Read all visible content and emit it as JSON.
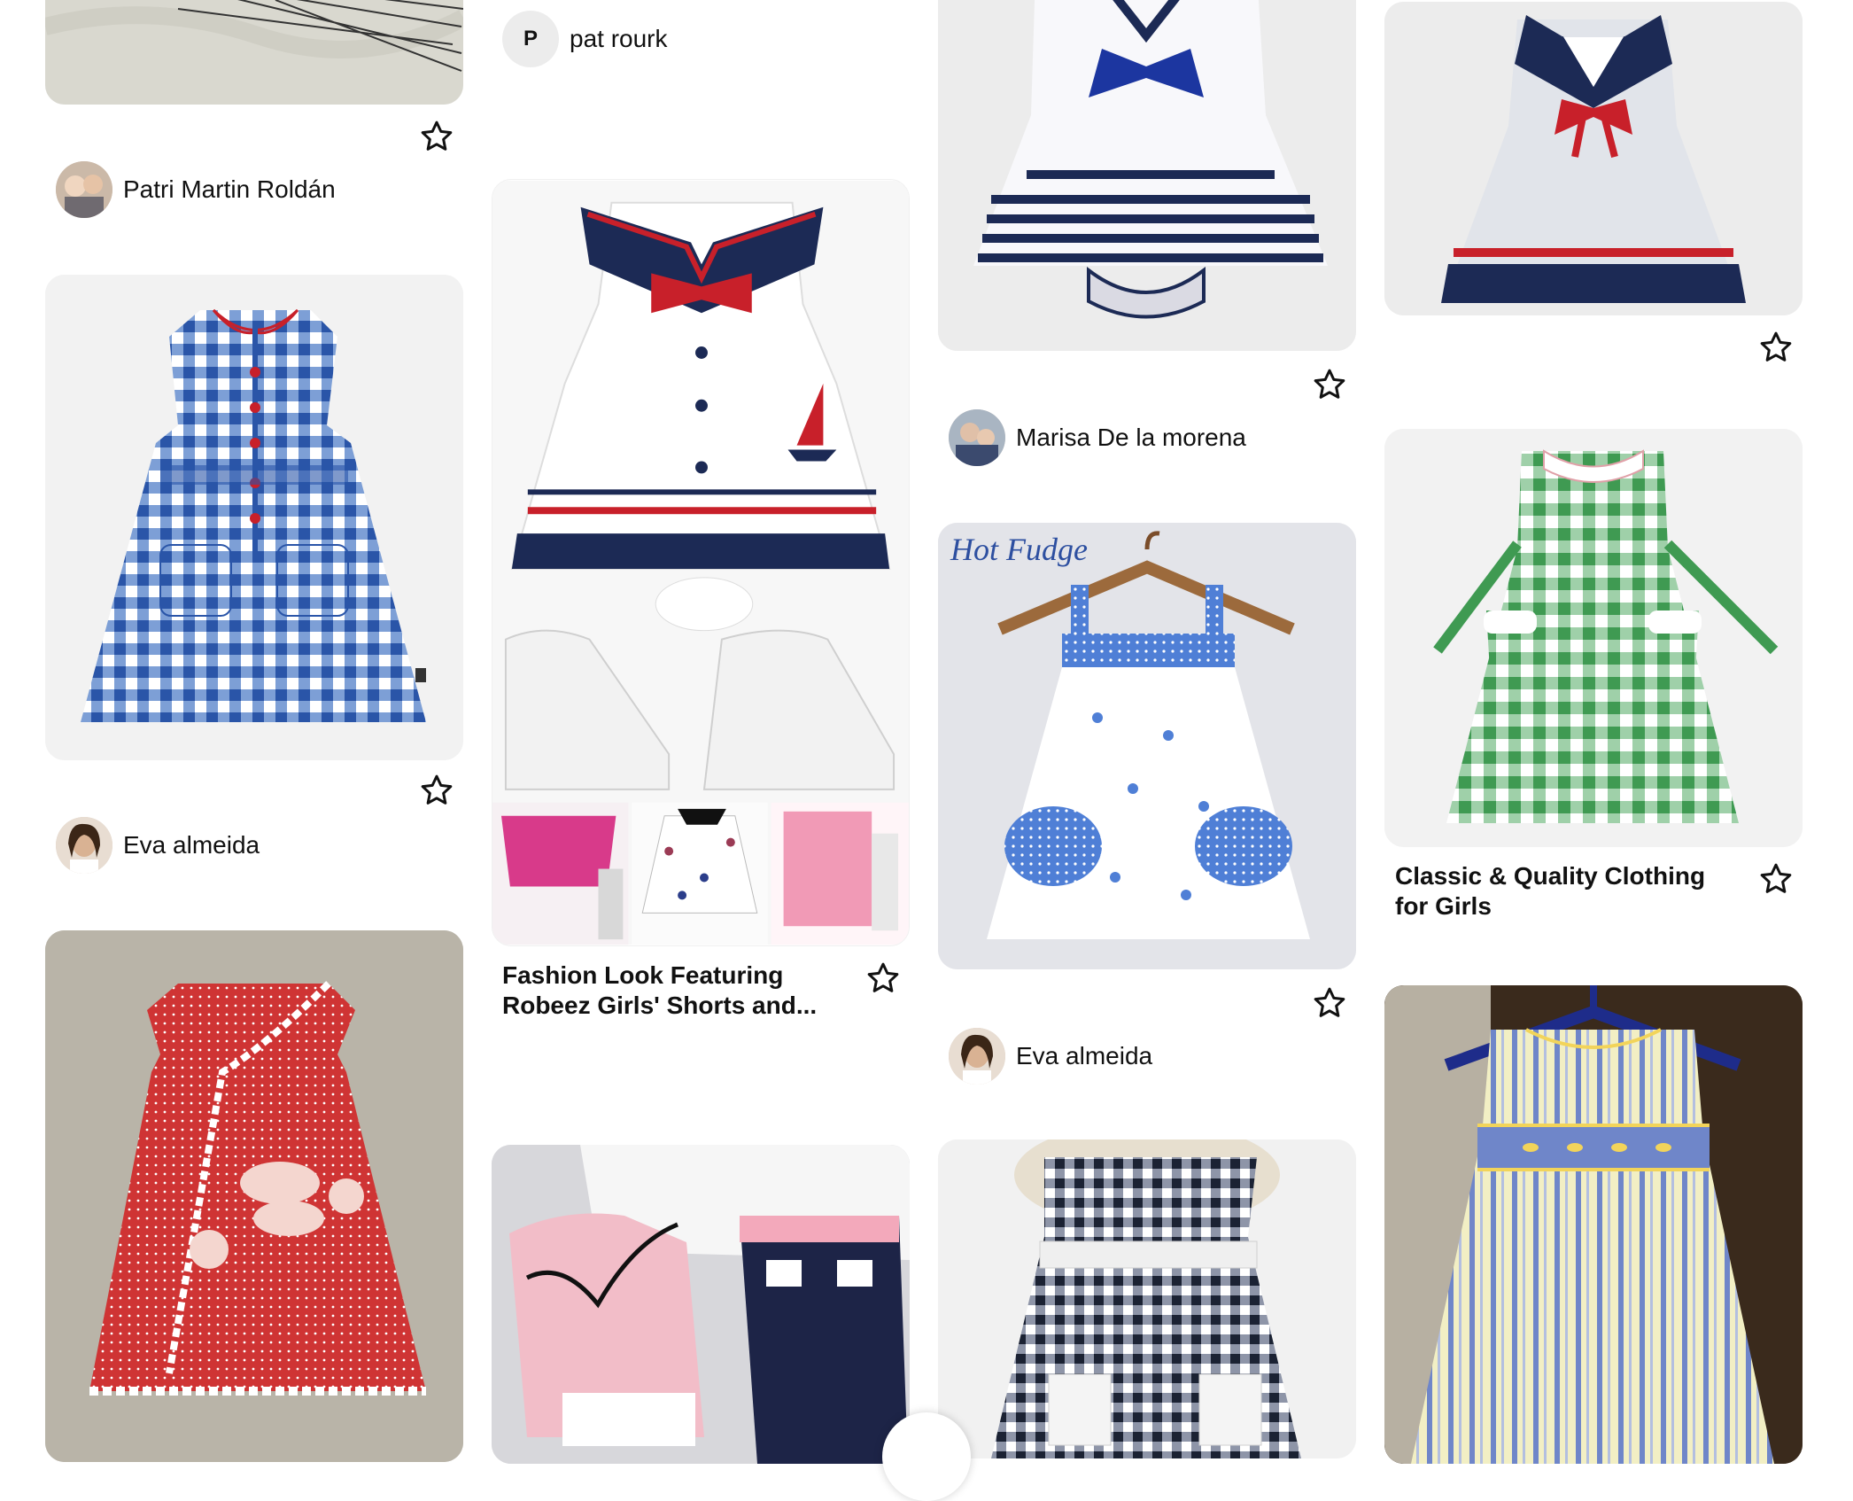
{
  "pins": {
    "c1": {
      "top_author": "Patri Martin Roldán",
      "mid_author": "Eva almeida"
    },
    "c2": {
      "top_author": "pat rourk",
      "top_author_initial": "P",
      "mid_title": "Fashion Look Featuring Robeez Girls' Shorts and..."
    },
    "c3": {
      "top_author": "Marisa De la morena",
      "mid_author": "Eva almeida",
      "img_caption": "Hot Fudge"
    },
    "c4": {
      "mid_title": "Classic & Quality Clothing for Girls"
    }
  },
  "icons": {
    "save": "star-icon",
    "avatar": "avatar-photo"
  },
  "colors": {
    "navy": "#1c2a55",
    "red": "#c8202a",
    "blue_gingham": "#2a55a8",
    "green_gingham": "#3f9a52",
    "polka_red": "#cf3434"
  }
}
